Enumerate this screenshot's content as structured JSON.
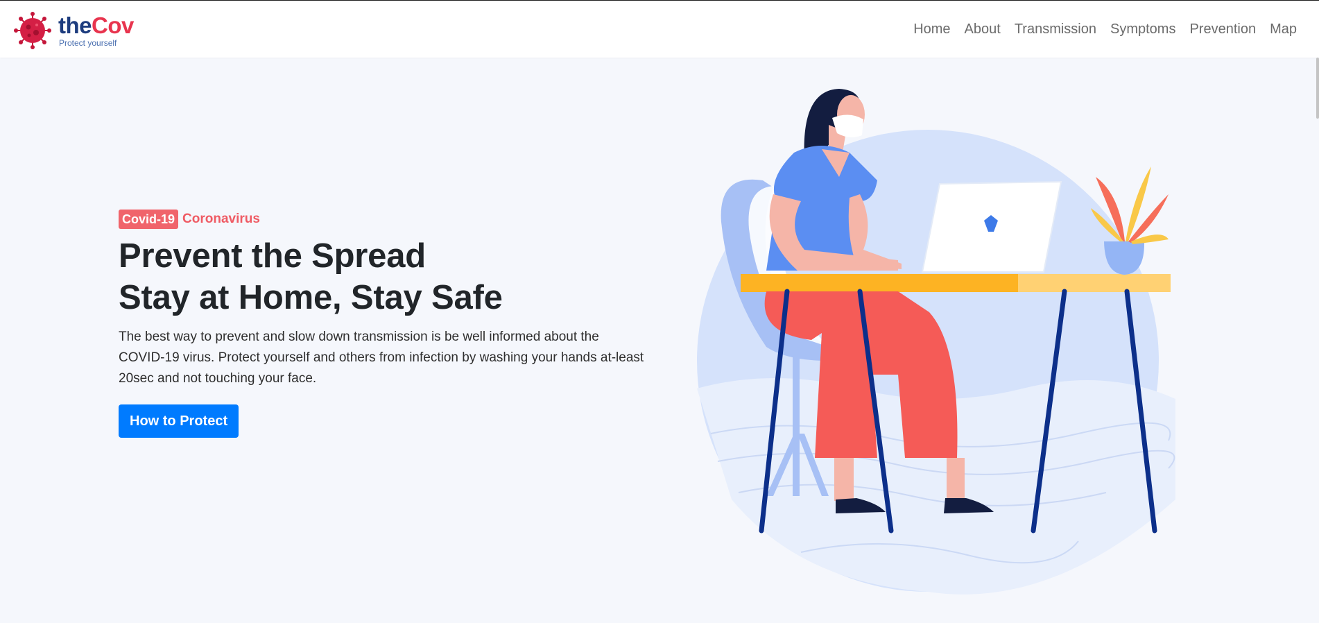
{
  "brand": {
    "name_part1": "the",
    "name_part2": "Cov",
    "tagline": "Protect yourself"
  },
  "nav": {
    "items": [
      {
        "label": "Home"
      },
      {
        "label": "About"
      },
      {
        "label": "Transmission"
      },
      {
        "label": "Symptoms"
      },
      {
        "label": "Prevention"
      },
      {
        "label": "Map"
      }
    ]
  },
  "hero": {
    "badge": "Covid-19",
    "badge_suffix": "Coronavirus",
    "headline_line1": "Prevent the Spread",
    "headline_line2": "Stay at Home, Stay Safe",
    "lead": "The best way to prevent and slow down transmission is be well informed about the COVID-19 virus. Protect yourself and others from infection by washing your hands at-least 20sec and not touching your face.",
    "cta_label": "How to Protect"
  },
  "colors": {
    "accent": "#007bff",
    "brand_red": "#e8344e",
    "brand_navy": "#1d3c7e",
    "badge": "#f0646b"
  },
  "icons": {
    "logo": "virus-icon",
    "laptop_logo": "shield-logo-icon"
  }
}
